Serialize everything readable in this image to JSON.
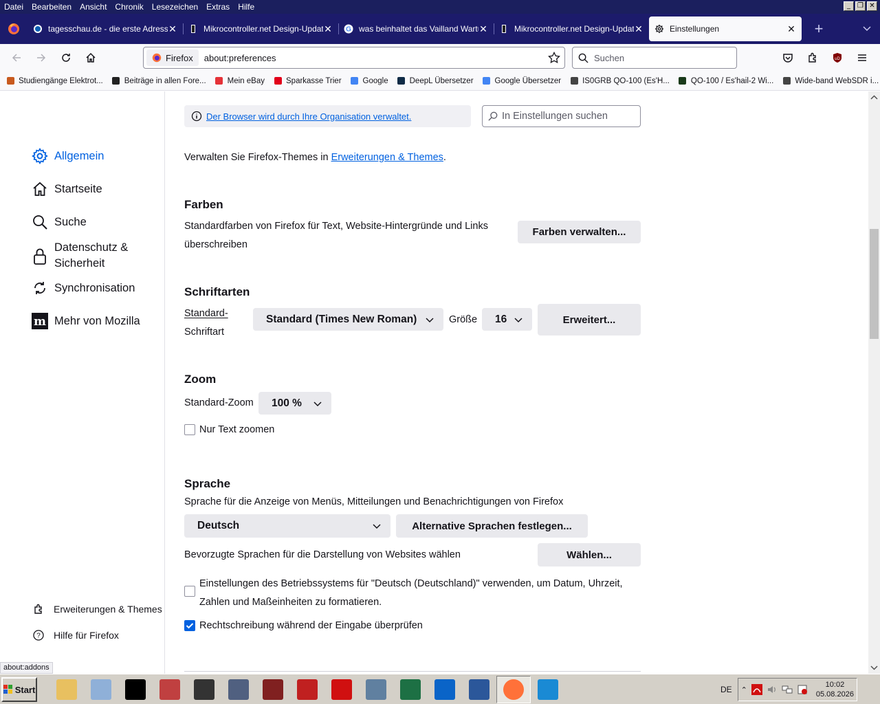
{
  "menubar": {
    "items": [
      "Datei",
      "Bearbeiten",
      "Ansicht",
      "Chronik",
      "Lesezeichen",
      "Extras",
      "Hilfe"
    ]
  },
  "tabs": [
    {
      "title": "tagesschau.de - die erste Adresse",
      "icon": "tagesschau-icon"
    },
    {
      "title": "Mikrocontroller.net Design-Update",
      "icon": "mikrocontroller-icon"
    },
    {
      "title": "was beinhaltet das Vailland Wartun",
      "icon": "google-icon"
    },
    {
      "title": "Mikrocontroller.net Design-Update",
      "icon": "mikrocontroller-icon"
    },
    {
      "title": "Einstellungen",
      "icon": "gear-icon",
      "active": true
    }
  ],
  "navbar": {
    "identity_label": "Firefox",
    "url": "about:preferences",
    "search_placeholder": "Suchen"
  },
  "bookmarks": [
    {
      "label": "Studiengänge Elektrot...",
      "icon": "bookmark-icon",
      "color": "#c85a1e"
    },
    {
      "label": "Beiträge in allen Fore...",
      "icon": "mikrocontroller-icon",
      "color": "#222222"
    },
    {
      "label": "Mein eBay",
      "icon": "ebay-icon",
      "color": "#e53238"
    },
    {
      "label": "Sparkasse Trier",
      "icon": "sparkasse-icon",
      "color": "#e2001a"
    },
    {
      "label": "Google",
      "icon": "google-icon",
      "color": "#4285f4"
    },
    {
      "label": "DeepL Übersetzer",
      "icon": "deepl-icon",
      "color": "#0f2b46"
    },
    {
      "label": "Google Übersetzer",
      "icon": "translate-icon",
      "color": "#4285f4"
    },
    {
      "label": "IS0GRB QO-100 (Es'H...",
      "icon": "globe-icon",
      "color": "#444444"
    },
    {
      "label": "QO-100 / Es'hail-2 Wi...",
      "icon": "websdr-icon",
      "color": "#1a3a1a"
    },
    {
      "label": "Wide-band WebSDR i...",
      "icon": "globe-icon",
      "color": "#444444"
    }
  ],
  "sidebar": {
    "categories": [
      {
        "label": "Allgemein",
        "icon": "gear-icon",
        "selected": true
      },
      {
        "label": "Startseite",
        "icon": "home-icon"
      },
      {
        "label": "Suche",
        "icon": "search-icon"
      },
      {
        "label": "Datenschutz &",
        "label2": "Sicherheit",
        "icon": "lock-icon"
      },
      {
        "label": "Synchronisation",
        "icon": "sync-icon"
      },
      {
        "label": "Mehr von Mozilla",
        "icon": "mozilla-icon"
      }
    ],
    "footer": [
      {
        "label": "Erweiterungen & Themes",
        "icon": "puzzle-icon"
      },
      {
        "label": "Hilfe für Firefox",
        "icon": "help-icon"
      }
    ]
  },
  "main": {
    "policy_notice": "Der Browser wird durch Ihre Organisation verwaltet.",
    "find_placeholder": "In Einstellungen suchen",
    "themes_text": "Verwalten Sie Firefox-Themes in",
    "themes_link": "Erweiterungen & Themes",
    "themes_end": ".",
    "colors": {
      "heading": "Farben",
      "desc1": "Standardfarben von Firefox für Text, Website-Hintergründe und Links",
      "desc2": "überschreiben",
      "button": "Farben verwalten..."
    },
    "fonts": {
      "heading": "Schriftarten",
      "label1": "Standard-",
      "label2": "Schriftart",
      "font_value": "Standard (Times New Roman)",
      "size_label": "Größe",
      "size_value": "16",
      "advanced_button": "Erweitert..."
    },
    "zoom": {
      "heading": "Zoom",
      "label": "Standard-Zoom",
      "value": "100 %",
      "text_only_label": "Nur Text zoomen",
      "text_only_checked": false
    },
    "language": {
      "heading": "Sprache",
      "desc": "Sprache für die Anzeige von Menüs, Mitteilungen und Benachrichtigungen von Firefox",
      "value": "Deutsch",
      "alt_button": "Alternative Sprachen festlegen...",
      "pref_desc": "Bevorzugte Sprachen für die Darstellung von Websites wählen",
      "choose_button": "Wählen...",
      "os_locale_line1": "Einstellungen des Betriebssystems für \"Deutsch (Deutschland)\" verwenden, um Datum, Uhrzeit,",
      "os_locale_line2": "Zahlen und Maßeinheiten zu formatieren.",
      "os_locale_checked": false,
      "spellcheck_label": "Rechtschreibung während der Eingabe überprüfen",
      "spellcheck_checked": true
    }
  },
  "status_text": "about:addons",
  "taskbar": {
    "start_label": "Start",
    "apps": [
      {
        "name": "explorer-icon",
        "color": "#e8c060"
      },
      {
        "name": "notepad-icon",
        "color": "#8fb0d8"
      },
      {
        "name": "cmd-icon",
        "color": "#000000"
      },
      {
        "name": "snipping-icon",
        "color": "#c04040"
      },
      {
        "name": "7zip-icon",
        "color": "#333333"
      },
      {
        "name": "calc-tool-icon",
        "color": "#506080"
      },
      {
        "name": "kicad-icon",
        "color": "#802020"
      },
      {
        "name": "eagle-icon",
        "color": "#c02020"
      },
      {
        "name": "acrobat-icon",
        "color": "#d01010"
      },
      {
        "name": "calculator-icon",
        "color": "#6080a0"
      },
      {
        "name": "excel-icon",
        "color": "#1d7044"
      },
      {
        "name": "outlook-icon",
        "color": "#0a64c8"
      },
      {
        "name": "word-icon",
        "color": "#2b579a"
      },
      {
        "name": "firefox-icon",
        "color": "#ff7139",
        "active": true
      },
      {
        "name": "teamviewer-icon",
        "color": "#1a8ad4"
      }
    ],
    "lang": "DE",
    "time": "10:02",
    "date": "05.08.2026"
  }
}
